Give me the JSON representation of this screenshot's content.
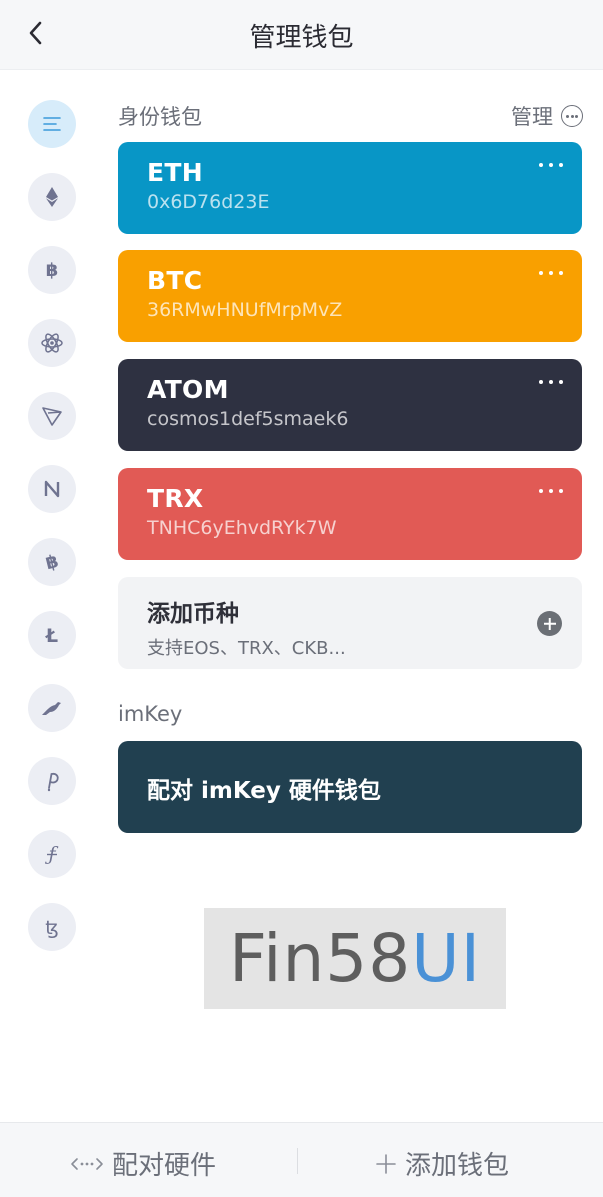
{
  "header": {
    "title": "管理钱包"
  },
  "sidebar": {
    "coins": [
      {
        "name": "identity-list-icon",
        "active": true
      },
      {
        "name": "eth-icon"
      },
      {
        "name": "btc-icon"
      },
      {
        "name": "atom-icon"
      },
      {
        "name": "trx-icon"
      },
      {
        "name": "nervos-icon"
      },
      {
        "name": "bch-icon"
      },
      {
        "name": "ltc-icon"
      },
      {
        "name": "kusama-icon"
      },
      {
        "name": "polkadot-icon"
      },
      {
        "name": "filecoin-icon"
      },
      {
        "name": "tezos-icon"
      }
    ]
  },
  "identity": {
    "label": "身份钱包",
    "manage_label": "管理",
    "wallets": [
      {
        "symbol": "ETH",
        "address": "0x6D76d23E",
        "color": "#0896c6"
      },
      {
        "symbol": "BTC",
        "address": "36RMwHNUfMrpMvZ",
        "color": "#f9a000"
      },
      {
        "symbol": "ATOM",
        "address": "cosmos1def5smaek6",
        "color": "#2e3141"
      },
      {
        "symbol": "TRX",
        "address": "TNHC6yEhvdRYk7W",
        "color": "#e15a55"
      }
    ],
    "add_coin": {
      "title": "添加币种",
      "subtitle": "支持EOS、TRX、CKB..."
    }
  },
  "imkey": {
    "label": "imKey",
    "pair_card": "配对 imKey 硬件钱包"
  },
  "watermark": {
    "part1": "Fin58",
    "part2": "UI"
  },
  "bottom": {
    "pair_hardware": "配对硬件",
    "add_wallet": "添加钱包"
  }
}
